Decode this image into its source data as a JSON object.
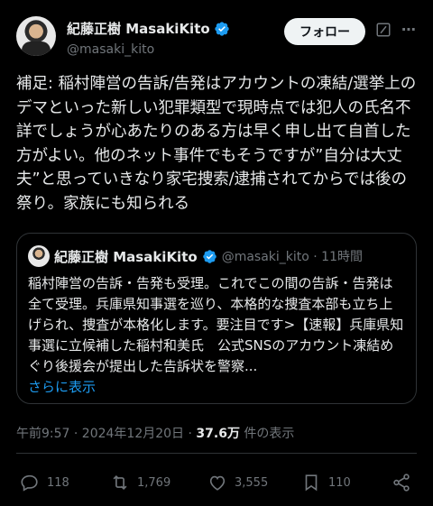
{
  "header": {
    "display_name": "紀藤正樹 MasakiKito",
    "handle": "@masaki_kito",
    "follow_label": "フォロー"
  },
  "tweet": {
    "text": "補足: 稲村陣営の告訴/告発はアカウントの凍結/選挙上のデマといった新しい犯罪類型で現時点では犯人の氏名不詳でしょうが心あたりのある方は早く申し出て自首した方がよい。他のネット事件でもそうですが”自分は大丈夫”と思っていきなり家宅捜索/逮捕されてからでは後の祭り。家族にも知られる"
  },
  "quote": {
    "display_name": "紀藤正樹 MasakiKito",
    "meta": "@masaki_kito · 11時間",
    "text": "稲村陣営の告訴・告発も受理。これでこの間の告訴・告発は全て受理。兵庫県知事選を巡り、本格的な捜査本部も立ち上げられ、捜査が本格化します。要注目です>【速報】兵庫県知事選に立候補した稲村和美氏　公式SNSのアカウント凍結めぐり後援会が提出した告訴状を警察...",
    "show_more": "さらに表示"
  },
  "meta": {
    "timestamp": "午前9:57 · 2024年12月20日 · ",
    "views_count": "37.6万",
    "views_label": " 件の表示"
  },
  "actions": {
    "replies": "118",
    "reposts": "1,769",
    "likes": "3,555",
    "bookmarks": "110"
  },
  "colors": {
    "background": "#000000",
    "text": "#e7e9ea",
    "secondary": "#71767b",
    "accent": "#1d9bf0",
    "border": "#2f3336"
  },
  "icons": [
    "verified-badge-icon",
    "grok-icon",
    "more-icon",
    "reply-icon",
    "repost-icon",
    "like-icon",
    "bookmark-icon",
    "share-icon"
  ]
}
